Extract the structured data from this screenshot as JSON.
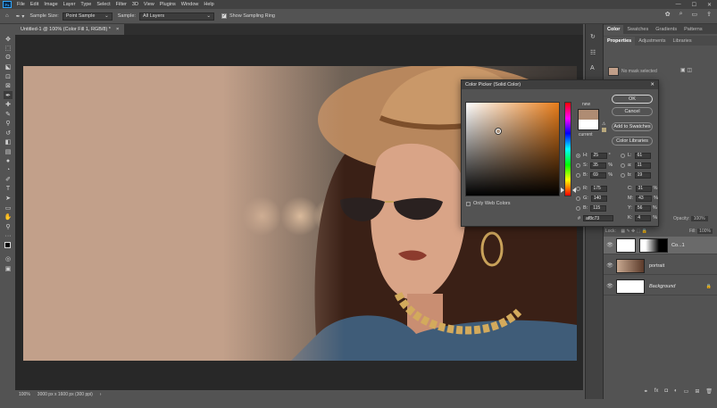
{
  "app": {
    "menus": [
      "File",
      "Edit",
      "Image",
      "Layer",
      "Type",
      "Select",
      "Filter",
      "3D",
      "View",
      "Plugins",
      "Window",
      "Help"
    ],
    "window_controls": [
      "—",
      "☐",
      "✕"
    ]
  },
  "options": {
    "sample_size_label": "Sample Size:",
    "sample_size_value": "Point Sample",
    "sample_label": "Sample:",
    "sample_value": "All Layers",
    "show_ring_label": "Show Sampling Ring",
    "show_ring_checked": true
  },
  "document": {
    "tab_title": "Untitled-1 @ 100% (Color Fill 1, RGB/8) *",
    "zoom": "100%",
    "dimensions": "3000 px x 1600 px (300 ppi)"
  },
  "panels": {
    "top_tabs": [
      "Color",
      "Swatches",
      "Gradients",
      "Patterns"
    ],
    "prop_tabs": [
      "Properties",
      "Adjustments",
      "Libraries"
    ],
    "no_mask_label": "No mask selected",
    "opacity_label": "Opacity:",
    "opacity_value": "100%",
    "fill_label": "Fill:",
    "fill_value": "100%",
    "lock_label": "Lock:",
    "layers": [
      {
        "name": "Co...1",
        "type": "fill"
      },
      {
        "name": "portrait",
        "type": "photo"
      },
      {
        "name": "Background",
        "type": "bg"
      }
    ]
  },
  "color_picker": {
    "title": "Color Picker (Solid Color)",
    "ok": "OK",
    "cancel": "Cancel",
    "add_to_swatches": "Add to Swatches",
    "color_libraries": "Color Libraries",
    "new_label": "new",
    "current_label": "current",
    "only_web_colors": "Only Web Colors",
    "new_color": "#af8c73",
    "current_color": "#ffffff",
    "hue_color": "#e87d1a",
    "hsb": {
      "H": "25",
      "S": "35",
      "B": "69"
    },
    "rgb": {
      "R": "175",
      "G": "140",
      "B": "115"
    },
    "lab": {
      "L": "61",
      "a": "11",
      "b": "19"
    },
    "cmyk": {
      "C": "31",
      "M": "43",
      "Y": "56",
      "K": "4"
    },
    "units": {
      "H": "°",
      "S": "%",
      "B": "%",
      "C": "%",
      "M": "%",
      "Y": "%",
      "K": "%"
    },
    "hex_label": "#",
    "hex": "af8c73"
  }
}
